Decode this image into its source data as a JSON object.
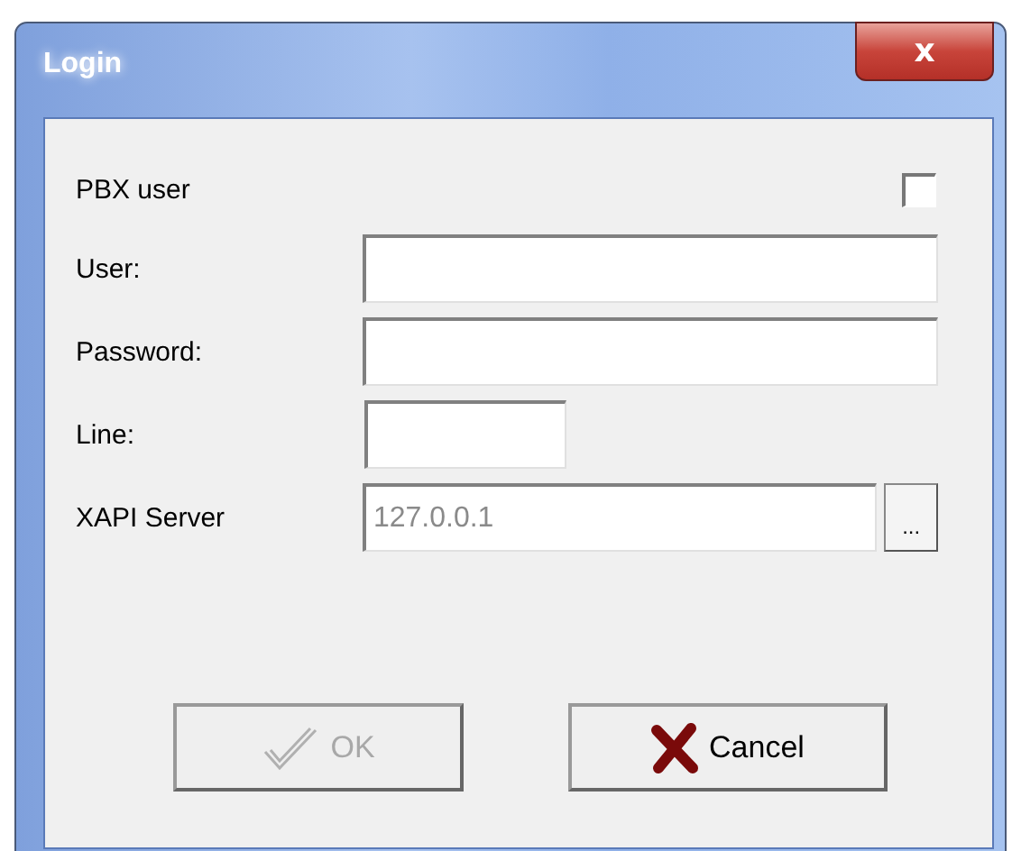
{
  "window": {
    "title": "Login",
    "close": "x"
  },
  "checkbox": {
    "label": "PBX user",
    "checked": false
  },
  "fields": [
    {
      "label": "User:",
      "kind": "wide"
    },
    {
      "label": "Password:",
      "kind": "wide"
    },
    {
      "label": "Line:",
      "kind": "short"
    },
    {
      "label": "XAPI Server",
      "kind": "browse",
      "value": "127.0.0.1",
      "disabled": true,
      "browse": "..."
    }
  ],
  "buttons": [
    {
      "label": "OK",
      "kind": "ok",
      "disabled": true
    },
    {
      "label": "Cancel",
      "kind": "cancel",
      "disabled": false
    }
  ]
}
